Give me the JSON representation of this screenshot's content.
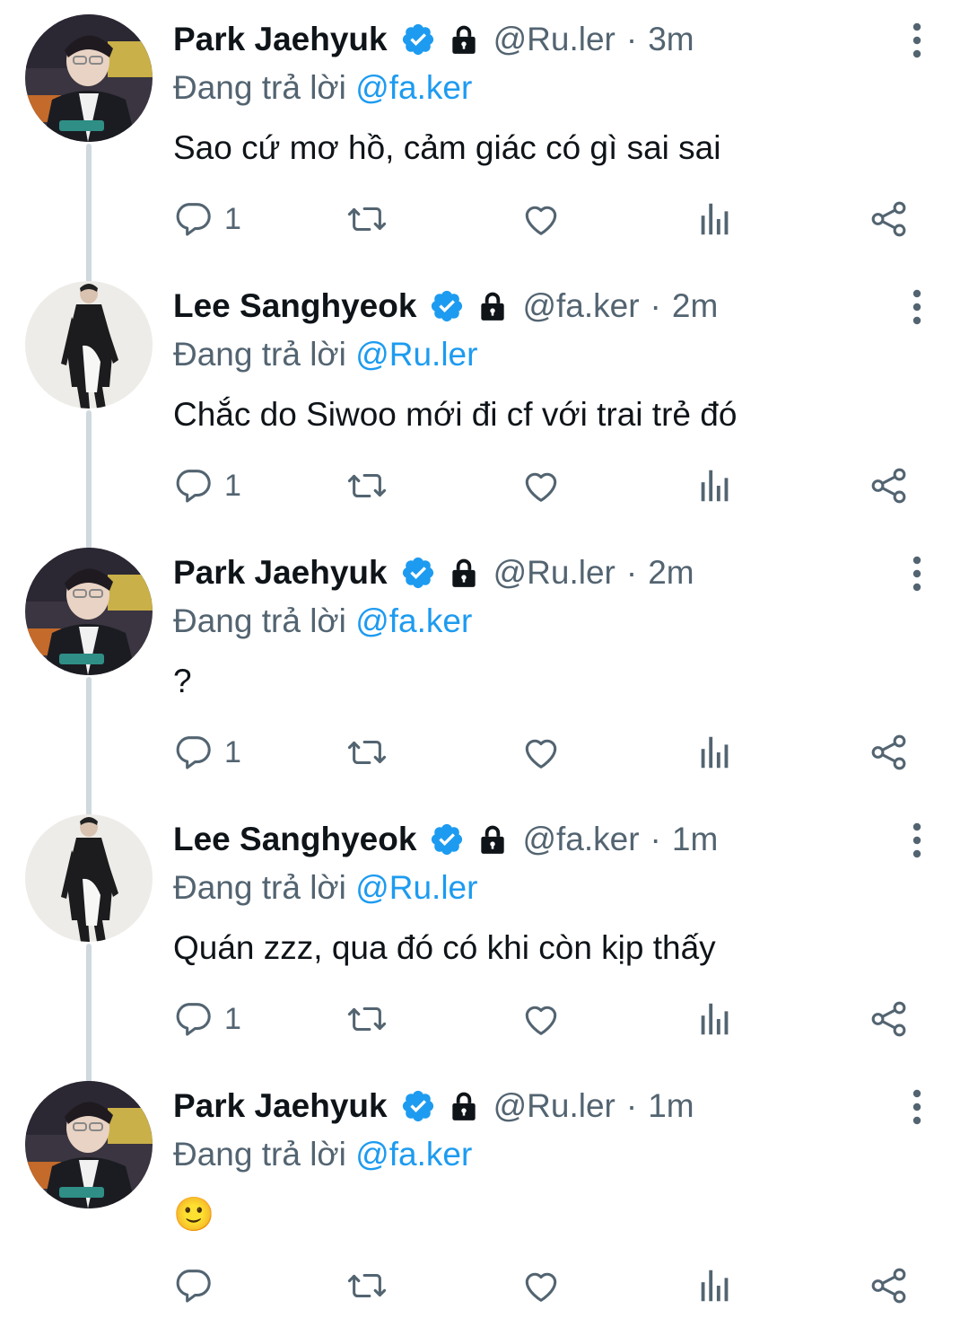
{
  "colors": {
    "text": "#0f1419",
    "secondary": "#536471",
    "accent": "#1d9bf0",
    "thread_line": "#cfd9de"
  },
  "icons": {
    "verified": "verified-badge-icon",
    "protected": "lock-icon",
    "more": "more-vertical-icon",
    "reply": "reply-icon",
    "retweet": "retweet-icon",
    "like": "heart-icon",
    "views": "bar-chart-icon",
    "share": "share-icon"
  },
  "tweets": [
    {
      "name": "Park Jaehyuk",
      "handle": "@Ru.ler",
      "separator": "·",
      "time": "3m",
      "reply_prefix": "Đang trả lời",
      "reply_to": "@fa.ker",
      "text": "Sao cứ mơ hồ, cảm giác có gì sai sai",
      "reply_count": "1",
      "avatar": "ruler"
    },
    {
      "name": "Lee Sanghyeok",
      "handle": "@fa.ker",
      "separator": "·",
      "time": "2m",
      "reply_prefix": "Đang trả lời",
      "reply_to": "@Ru.ler",
      "text": "Chắc do Siwoo mới đi cf với trai trẻ đó",
      "reply_count": "1",
      "avatar": "faker"
    },
    {
      "name": "Park Jaehyuk",
      "handle": "@Ru.ler",
      "separator": "·",
      "time": "2m",
      "reply_prefix": "Đang trả lời",
      "reply_to": "@fa.ker",
      "text": "?",
      "reply_count": "1",
      "avatar": "ruler"
    },
    {
      "name": "Lee Sanghyeok",
      "handle": "@fa.ker",
      "separator": "·",
      "time": "1m",
      "reply_prefix": "Đang trả lời",
      "reply_to": "@Ru.ler",
      "text": "Quán zzz, qua đó có khi còn kịp thấy",
      "reply_count": "1",
      "avatar": "faker"
    },
    {
      "name": "Park Jaehyuk",
      "handle": "@Ru.ler",
      "separator": "·",
      "time": "1m",
      "reply_prefix": "Đang trả lời",
      "reply_to": "@fa.ker",
      "text": "🙂",
      "reply_count": "",
      "avatar": "ruler"
    }
  ]
}
